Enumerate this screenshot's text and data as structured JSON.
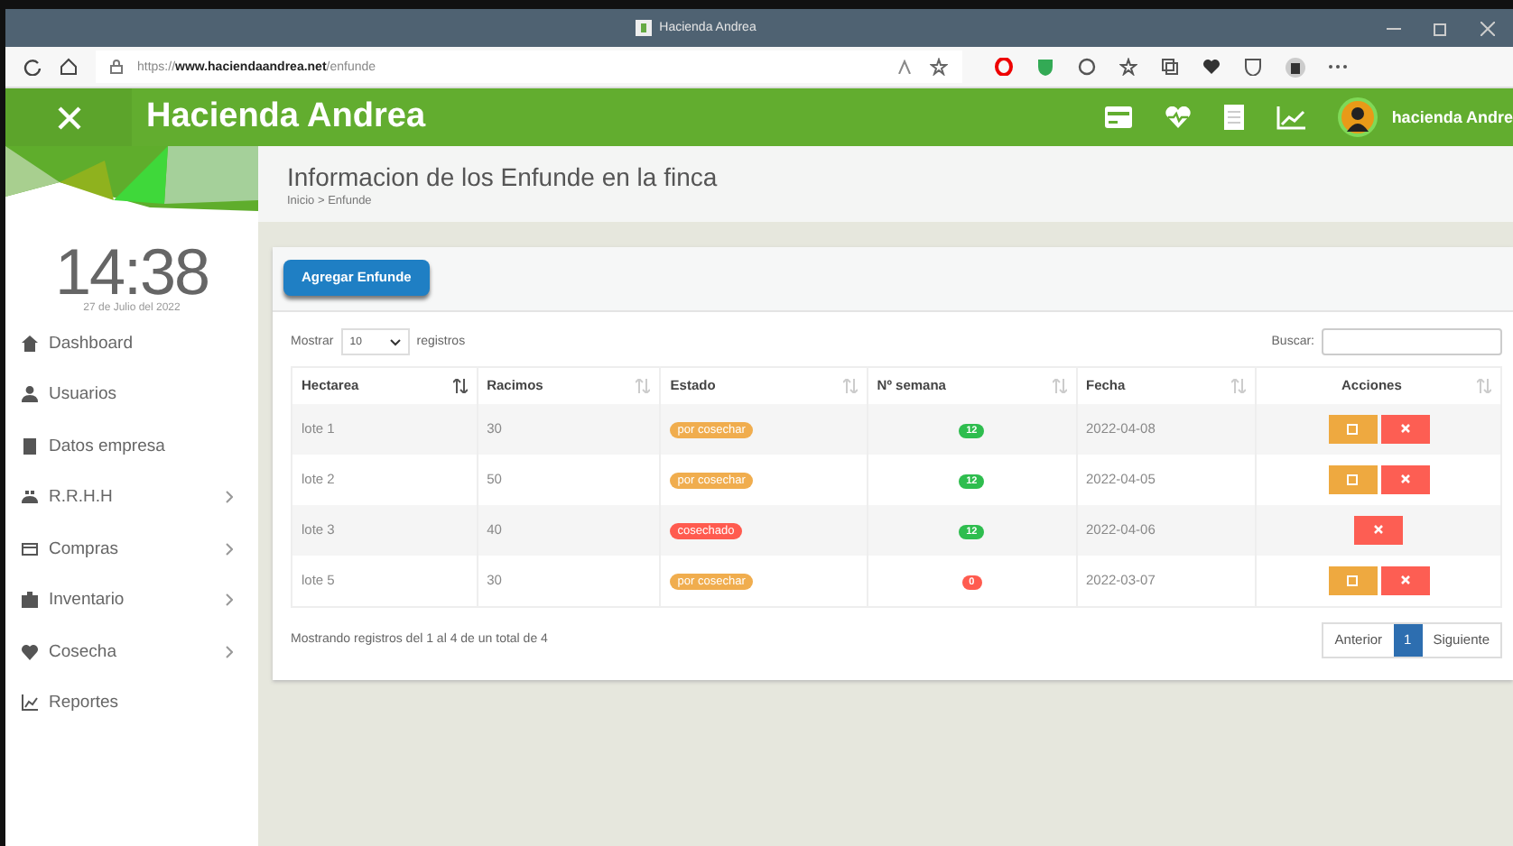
{
  "browser": {
    "tab_title": "Hacienda Andrea",
    "url": "https://**www.haciendaandrea.net**/enfunde"
  },
  "header": {
    "title": "Hacienda Andrea",
    "user": "hacienda Andre"
  },
  "sidebar": {
    "time": "14:38",
    "date": "27 de Julio del 2022",
    "items": [
      {
        "label": "Dashboard",
        "has_submenu": false
      },
      {
        "label": "Usuarios",
        "has_submenu": false
      },
      {
        "label": "Datos empresa",
        "has_submenu": false
      },
      {
        "label": "R.R.H.H",
        "has_submenu": true
      },
      {
        "label": "Compras",
        "has_submenu": true
      },
      {
        "label": "Inventario",
        "has_submenu": true
      },
      {
        "label": "Cosecha",
        "has_submenu": true
      },
      {
        "label": "Reportes",
        "has_submenu": false
      }
    ]
  },
  "page": {
    "title": "Informacion de los Enfunde en la finca",
    "breadcrumb": "Inicio > Enfunde"
  },
  "add_button": "Agregar Enfunde",
  "length": {
    "prefix": "Mostrar",
    "value": "10",
    "suffix": "registros"
  },
  "search": {
    "label": "Buscar:"
  },
  "table": {
    "columns": [
      {
        "label": "Hectarea",
        "sorted": true
      },
      {
        "label": "Racimos",
        "sorted": false
      },
      {
        "label": "Estado",
        "sorted": false
      },
      {
        "label": "Nº semana",
        "sorted": false
      },
      {
        "label": "Fecha",
        "sorted": false
      },
      {
        "label": "Acciones",
        "sorted": false
      }
    ],
    "rows": [
      {
        "hectarea": "lote 1",
        "racimos": "30",
        "estado": {
          "text": "por cosechar",
          "color": "#f0ad4e"
        },
        "semana": {
          "text": "12",
          "color": "#2ebd4e"
        },
        "fecha": "2022-04-08",
        "editable": true
      },
      {
        "hectarea": "lote 2",
        "racimos": "50",
        "estado": {
          "text": "por cosechar",
          "color": "#f0ad4e"
        },
        "semana": {
          "text": "12",
          "color": "#2ebd4e"
        },
        "fecha": "2022-04-05",
        "editable": true
      },
      {
        "hectarea": "lote 3",
        "racimos": "40",
        "estado": {
          "text": "cosechado",
          "color": "#ff5b4f"
        },
        "semana": {
          "text": "12",
          "color": "#2ebd4e"
        },
        "fecha": "2022-04-06",
        "editable": false
      },
      {
        "hectarea": "lote 5",
        "racimos": "30",
        "estado": {
          "text": "por cosechar",
          "color": "#f0ad4e"
        },
        "semana": {
          "text": "0",
          "color": "#ff5b4f"
        },
        "fecha": "2022-03-07",
        "editable": true
      }
    ]
  },
  "info": "Mostrando registros del 1 al 4 de un total de 4",
  "pagination": [
    {
      "label": "Anterior",
      "selected": false
    },
    {
      "label": "1",
      "selected": true
    },
    {
      "label": "Siguiente",
      "selected": false
    }
  ]
}
